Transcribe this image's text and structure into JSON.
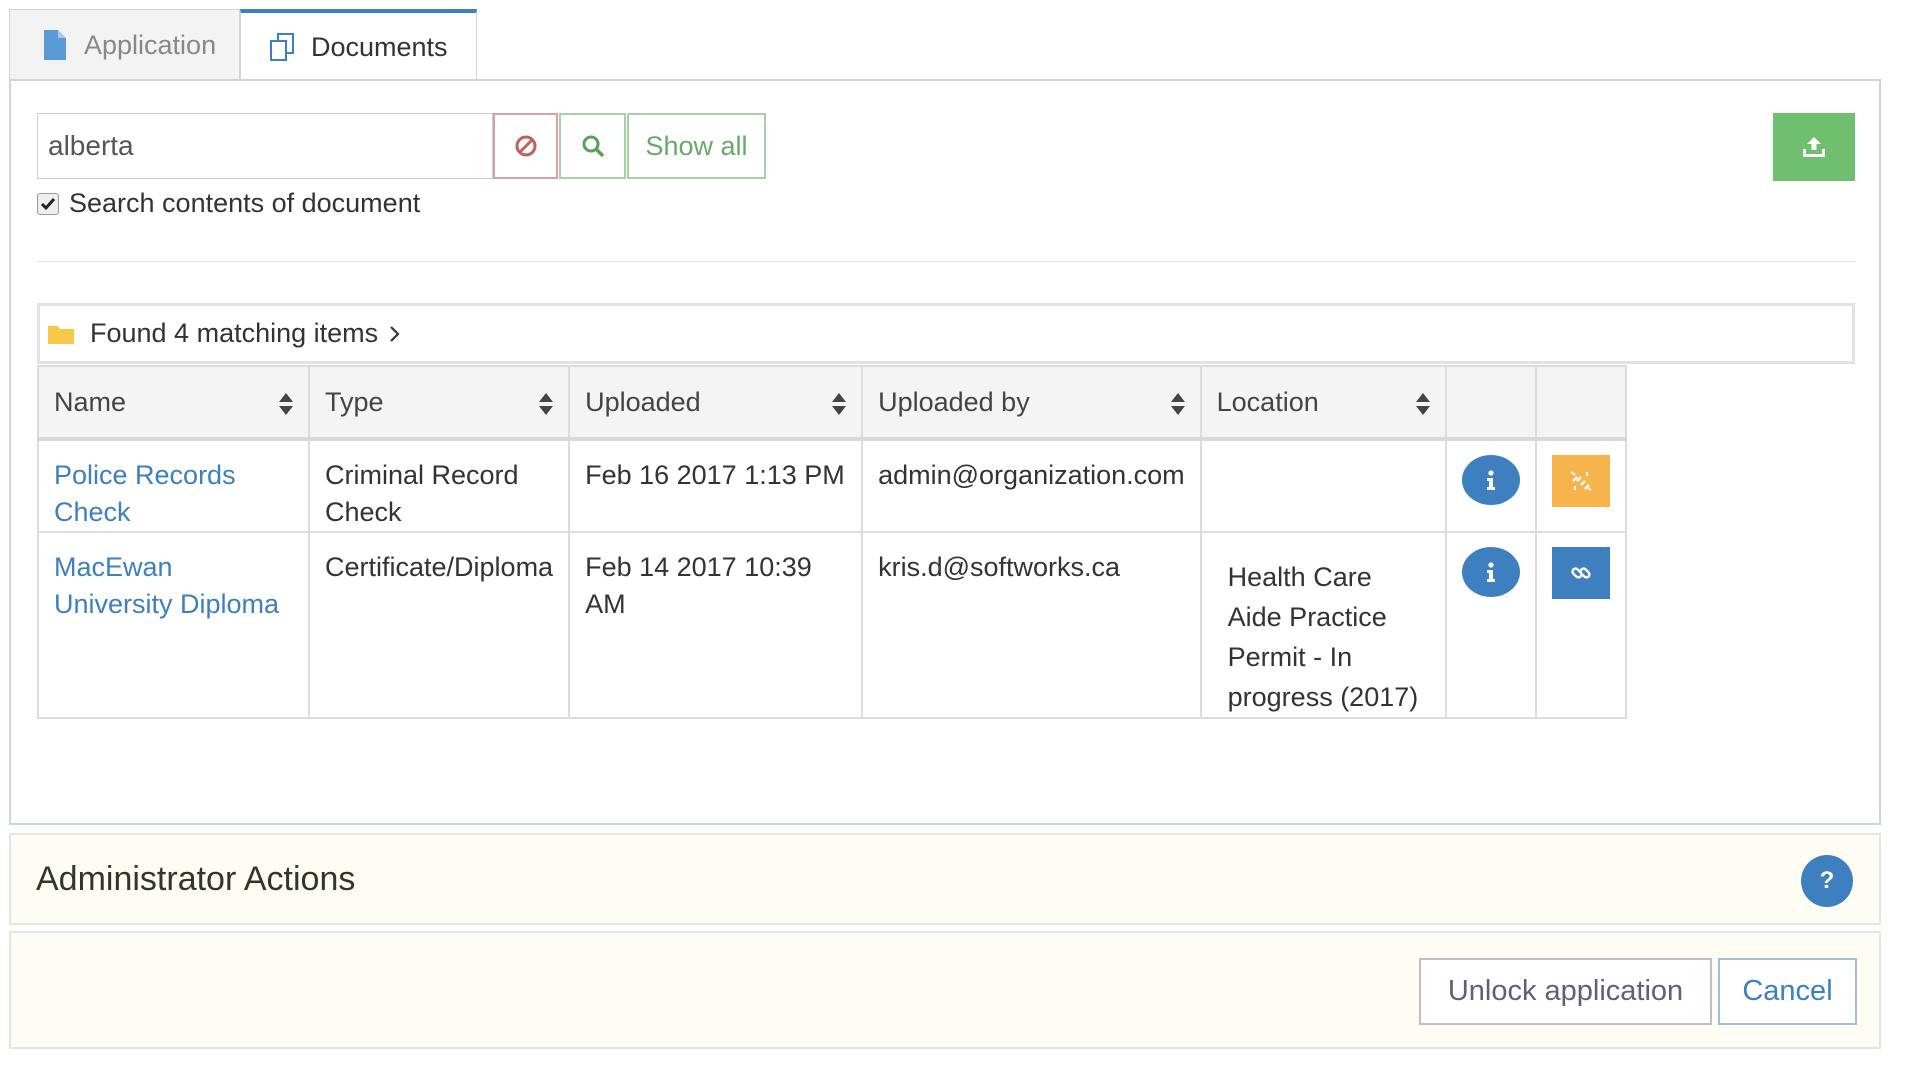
{
  "tabs": [
    {
      "label": "Application",
      "icon": "file-icon"
    },
    {
      "label": "Documents",
      "icon": "documents-icon"
    }
  ],
  "search": {
    "value": "alberta",
    "show_all_label": "Show all",
    "search_contents_label": "Search contents of document",
    "search_contents_checked": true
  },
  "results": {
    "found_label": "Found 4 matching items",
    "columns": [
      "Name",
      "Type",
      "Uploaded",
      "Uploaded by",
      "Location"
    ],
    "rows": [
      {
        "name": "Police Records Check",
        "type": "Criminal Record Check",
        "uploaded": "Feb 16 2017 1:13 PM",
        "uploaded_by": "admin@organization.com",
        "location": "",
        "link_state": "unlink"
      },
      {
        "name": "MacEwan University Diploma",
        "type": "Certificate/Diploma",
        "uploaded": "Feb 14 2017 10:39 AM",
        "uploaded_by": "kris.d@softworks.ca",
        "location": "Health Care Aide Practice Permit - In progress (2017)",
        "link_state": "link"
      }
    ]
  },
  "admin": {
    "title": "Administrator Actions",
    "help_label": "?"
  },
  "footer": {
    "unlock_label": "Unlock application",
    "cancel_label": "Cancel"
  },
  "colors": {
    "accent": "#3d7fbf",
    "success": "#6fbf6f",
    "warning": "#f8b44c",
    "panel_bg": "#fffdf3"
  }
}
